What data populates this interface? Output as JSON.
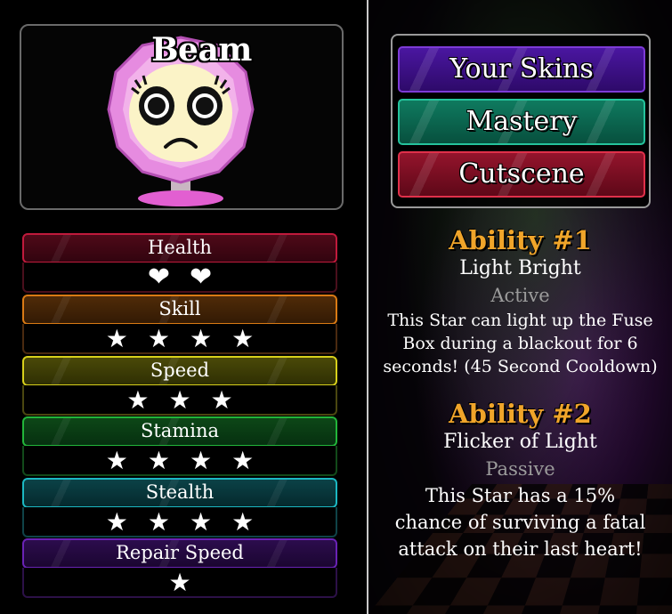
{
  "character": {
    "name": "Beam"
  },
  "stats": [
    {
      "label": "Health",
      "icon": "heart-icon",
      "glyph": "❤",
      "rating": 2,
      "max": 2,
      "color": "#c01a3c"
    },
    {
      "label": "Skill",
      "icon": "star-icon",
      "glyph": "★",
      "rating": 4,
      "color": "#d97a14"
    },
    {
      "label": "Speed",
      "icon": "star-icon",
      "glyph": "★",
      "rating": 3,
      "color": "#d7d01b"
    },
    {
      "label": "Stamina",
      "icon": "star-icon",
      "glyph": "★",
      "rating": 4,
      "color": "#22b53a"
    },
    {
      "label": "Stealth",
      "icon": "star-icon",
      "glyph": "★",
      "rating": 4,
      "color": "#1bb8c2"
    },
    {
      "label": "Repair Speed",
      "icon": "star-icon",
      "glyph": "★",
      "rating": 1,
      "color": "#6a22b5"
    }
  ],
  "menu": {
    "skins_label": "Your Skins",
    "mastery_label": "Mastery",
    "cutscene_label": "Cutscene"
  },
  "abilities": [
    {
      "title": "Ability #1",
      "name": "Light Bright",
      "type": "Active",
      "description": "This Star can light up the Fuse Box during a blackout for 6 seconds! (45 Second Cooldown)"
    },
    {
      "title": "Ability #2",
      "name": "Flicker of Light",
      "type": "Passive",
      "description": "This Star has a 15% chance of surviving a fatal attack on their last heart!"
    }
  ],
  "colors": {
    "ability_title": "#f0a52a",
    "ability_type": "#9b9b9b",
    "skins_button": "#4a16a0",
    "mastery_button": "#0f7a5f",
    "cutscene_button": "#94142c"
  }
}
